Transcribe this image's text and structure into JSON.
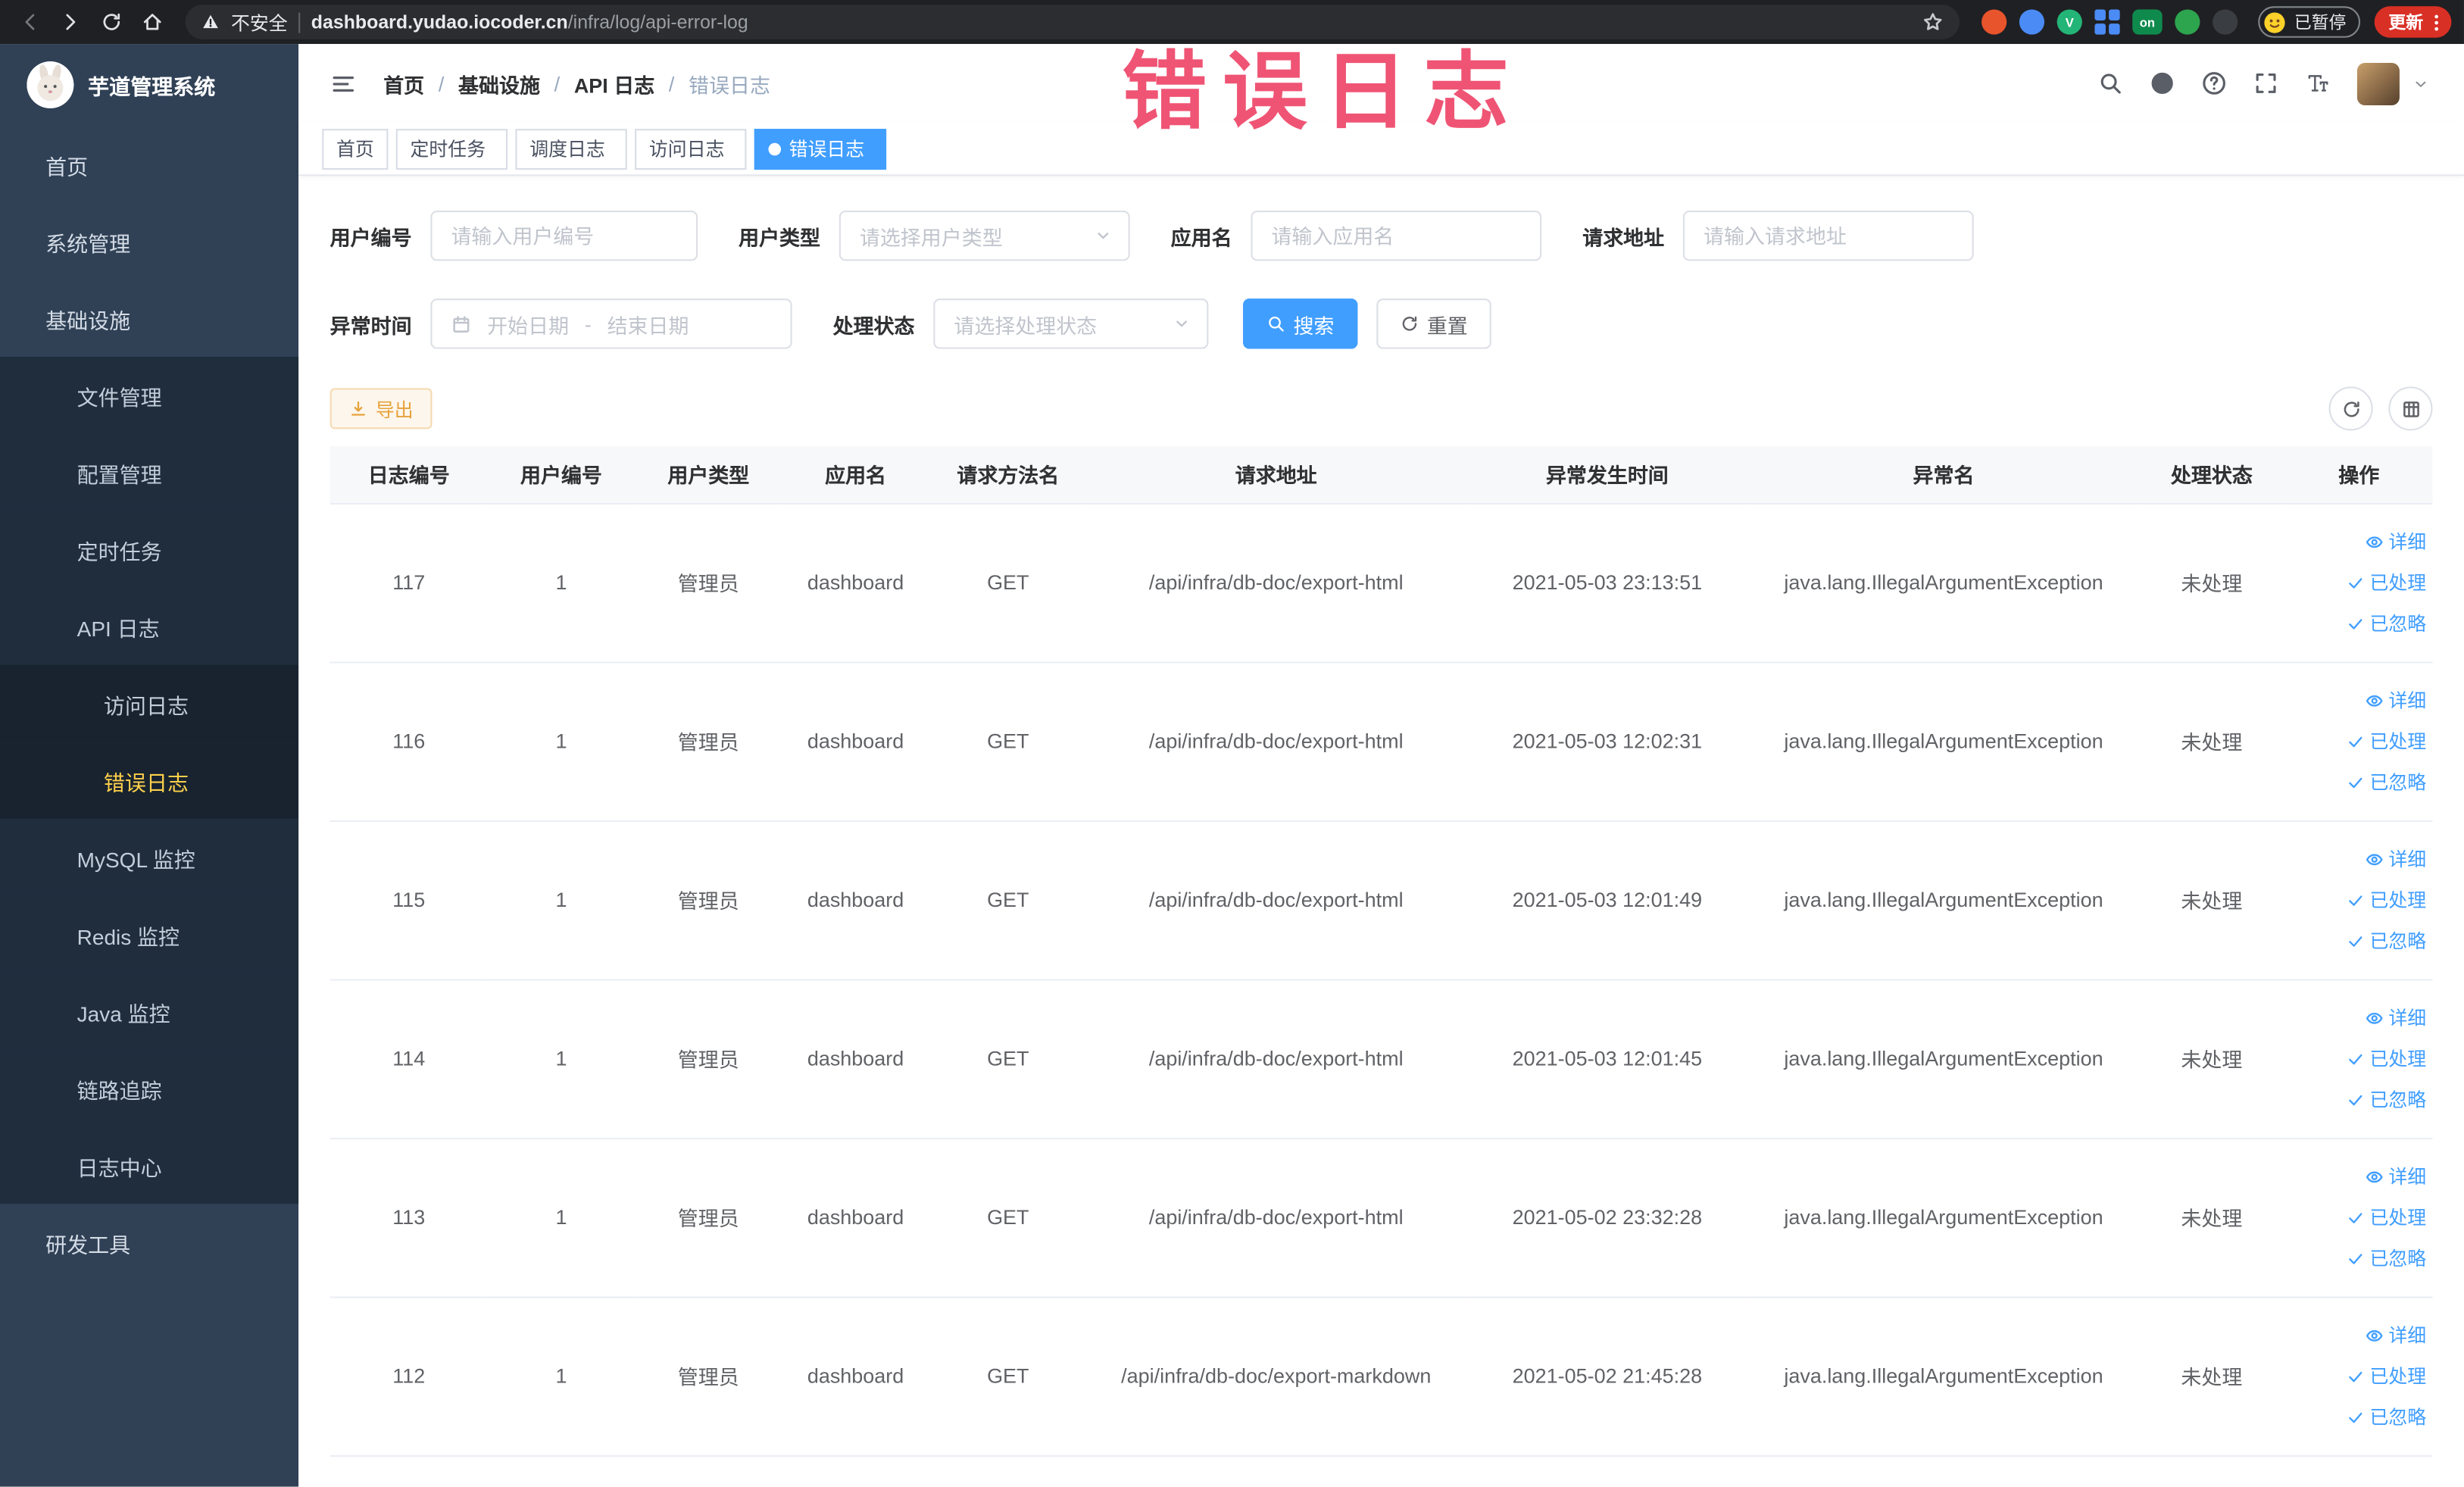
{
  "overlay": {
    "text": "错误日志"
  },
  "browser": {
    "security_label": "不安全",
    "url_domain": "dashboard.yudao.iocoder.cn",
    "url_path": "/infra/log/api-error-log",
    "paused_badge": "已暂停",
    "update_button": "更新",
    "extensions": [
      {
        "name": "extension-orange-circle",
        "kind": "circle",
        "color": "#e8542c",
        "label": ""
      },
      {
        "name": "extension-blue-drop",
        "kind": "circle",
        "color": "#4b8bf5",
        "label": ""
      },
      {
        "name": "extension-green-v",
        "kind": "circle",
        "color": "#23b577",
        "label": "V"
      },
      {
        "name": "extension-blue-grid",
        "kind": "grid",
        "color": "#4b8bf5",
        "label": ""
      },
      {
        "name": "extension-on-badge",
        "kind": "tag",
        "color": "#0f8a4d",
        "label": "on"
      },
      {
        "name": "extension-green-sprout",
        "kind": "circle",
        "color": "#2da44e",
        "label": ""
      },
      {
        "name": "extension-paw",
        "kind": "circle",
        "color": "#3a3d42",
        "label": ""
      }
    ]
  },
  "sidebar": {
    "title": "芋道管理系统",
    "items": [
      {
        "key": "home",
        "label": "首页",
        "icon": "home",
        "level": 1
      },
      {
        "key": "system",
        "label": "系统管理",
        "icon": "gear",
        "level": 1,
        "expand": "down"
      },
      {
        "key": "infra",
        "label": "基础设施",
        "icon": "monitor",
        "level": 1,
        "expand": "up"
      },
      {
        "key": "file",
        "label": "文件管理",
        "icon": "folder",
        "level": 2
      },
      {
        "key": "config",
        "label": "配置管理",
        "icon": "edit",
        "level": 2
      },
      {
        "key": "job",
        "label": "定时任务",
        "icon": "clock",
        "level": 2
      },
      {
        "key": "api-log",
        "label": "API 日志",
        "icon": "doc",
        "level": 2,
        "expand": "up"
      },
      {
        "key": "access-log",
        "label": "访问日志",
        "icon": "edit",
        "level": 3
      },
      {
        "key": "error-log",
        "label": "错误日志",
        "icon": "edit",
        "level": 3,
        "active": true
      },
      {
        "key": "mysql",
        "label": "MySQL 监控",
        "icon": "db",
        "level": 2
      },
      {
        "key": "redis",
        "label": "Redis 监控",
        "icon": "db",
        "level": 2
      },
      {
        "key": "java",
        "label": "Java 监控",
        "icon": "monitor",
        "level": 2
      },
      {
        "key": "trace",
        "label": "链路追踪",
        "icon": "eye",
        "level": 2
      },
      {
        "key": "log-center",
        "label": "日志中心",
        "icon": "doc",
        "level": 2
      },
      {
        "key": "devtools",
        "label": "研发工具",
        "icon": "box",
        "level": 1,
        "expand": "down"
      }
    ]
  },
  "topbar": {
    "breadcrumb": [
      "首页",
      "基础设施",
      "API 日志",
      "错误日志"
    ]
  },
  "tabs": [
    {
      "label": "首页",
      "closable": false,
      "active": false
    },
    {
      "label": "定时任务",
      "closable": true,
      "active": false
    },
    {
      "label": "调度日志",
      "closable": true,
      "active": false
    },
    {
      "label": "访问日志",
      "closable": true,
      "active": false
    },
    {
      "label": "错误日志",
      "closable": true,
      "active": true
    }
  ],
  "filters": {
    "user_id": {
      "label": "用户编号",
      "placeholder": "请输入用户编号"
    },
    "user_type": {
      "label": "用户类型",
      "placeholder": "请选择用户类型"
    },
    "app_name": {
      "label": "应用名",
      "placeholder": "请输入应用名"
    },
    "request_url": {
      "label": "请求地址",
      "placeholder": "请输入请求地址"
    },
    "exception_time": {
      "label": "异常时间",
      "start_placeholder": "开始日期",
      "separator": "-",
      "end_placeholder": "结束日期"
    },
    "process_status": {
      "label": "处理状态",
      "placeholder": "请选择处理状态"
    },
    "search_button": "搜索",
    "reset_button": "重置"
  },
  "toolbar": {
    "export_label": "导出"
  },
  "table": {
    "columns": [
      "日志编号",
      "用户编号",
      "用户类型",
      "应用名",
      "请求方法名",
      "请求地址",
      "异常发生时间",
      "异常名",
      "处理状态",
      "操作"
    ],
    "actions": {
      "detail": "详细",
      "processed": "已处理",
      "ignored": "已忽略"
    },
    "rows": [
      {
        "id": "117",
        "user_id": "1",
        "user_type": "管理员",
        "app": "dashboard",
        "method": "GET",
        "url": "/api/infra/db-doc/export-html",
        "time": "2021-05-03 23:13:51",
        "exception": "java.lang.IllegalArgumentException",
        "status": "未处理"
      },
      {
        "id": "116",
        "user_id": "1",
        "user_type": "管理员",
        "app": "dashboard",
        "method": "GET",
        "url": "/api/infra/db-doc/export-html",
        "time": "2021-05-03 12:02:31",
        "exception": "java.lang.IllegalArgumentException",
        "status": "未处理"
      },
      {
        "id": "115",
        "user_id": "1",
        "user_type": "管理员",
        "app": "dashboard",
        "method": "GET",
        "url": "/api/infra/db-doc/export-html",
        "time": "2021-05-03 12:01:49",
        "exception": "java.lang.IllegalArgumentException",
        "status": "未处理"
      },
      {
        "id": "114",
        "user_id": "1",
        "user_type": "管理员",
        "app": "dashboard",
        "method": "GET",
        "url": "/api/infra/db-doc/export-html",
        "time": "2021-05-03 12:01:45",
        "exception": "java.lang.IllegalArgumentException",
        "status": "未处理"
      },
      {
        "id": "113",
        "user_id": "1",
        "user_type": "管理员",
        "app": "dashboard",
        "method": "GET",
        "url": "/api/infra/db-doc/export-html",
        "time": "2021-05-02 23:32:28",
        "exception": "java.lang.IllegalArgumentException",
        "status": "未处理"
      },
      {
        "id": "112",
        "user_id": "1",
        "user_type": "管理员",
        "app": "dashboard",
        "method": "GET",
        "url": "/api/infra/db-doc/export-markdown",
        "time": "2021-05-02 21:45:28",
        "exception": "java.lang.IllegalArgumentException",
        "status": "未处理"
      }
    ]
  },
  "colors": {
    "accent": "#409eff",
    "active_menu_text": "#ffd04b",
    "warning_text": "#e6a23c",
    "overlay_text": "#ef4b6d",
    "sidebar_bg": "#304156",
    "chrome_bg": "#1f2023",
    "update_button_bg": "#d93025"
  }
}
